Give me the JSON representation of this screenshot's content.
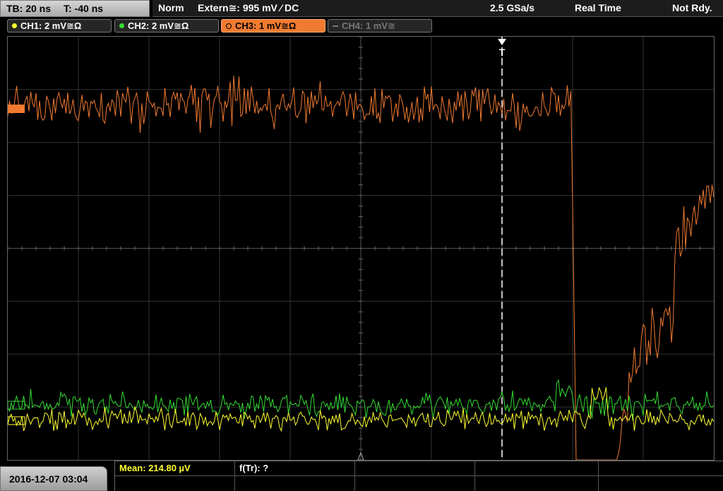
{
  "timebase": {
    "tb": "TB: 20 ns",
    "trigger_offset": "T: -40 ns"
  },
  "status": {
    "mode": "Norm",
    "trigger_source": "Extern≅: 995 mV ⁄ DC",
    "sample_rate": "2.5 GSa/s",
    "acq_mode": "Real Time",
    "state": "Not Rdy."
  },
  "channels": [
    {
      "label": "CH1: 2 mV≅Ω",
      "color": "#ffff33",
      "state": "on"
    },
    {
      "label": "CH2: 2 mV≅Ω",
      "color": "#33dd33",
      "state": "on"
    },
    {
      "label": "CH3: 1 mV≅Ω",
      "color": "#f07a30",
      "state": "active"
    },
    {
      "label": "CH4: 1 mV≅",
      "color": "#777777",
      "state": "off"
    }
  ],
  "trigger_marker": {
    "label": "T"
  },
  "footer": {
    "datetime": "2016-12-07 03:04",
    "measurements": [
      {
        "label": "Mean: 214.80 µV",
        "color": "#ffff33"
      },
      {
        "label": "f(Tr): ?",
        "color": "#ffffff"
      }
    ]
  },
  "colors": {
    "ch1": "#ffff33",
    "ch2": "#33dd33",
    "ch3": "#f07a30",
    "grid": "#3a3a3a",
    "accent": "#f07a30"
  }
}
